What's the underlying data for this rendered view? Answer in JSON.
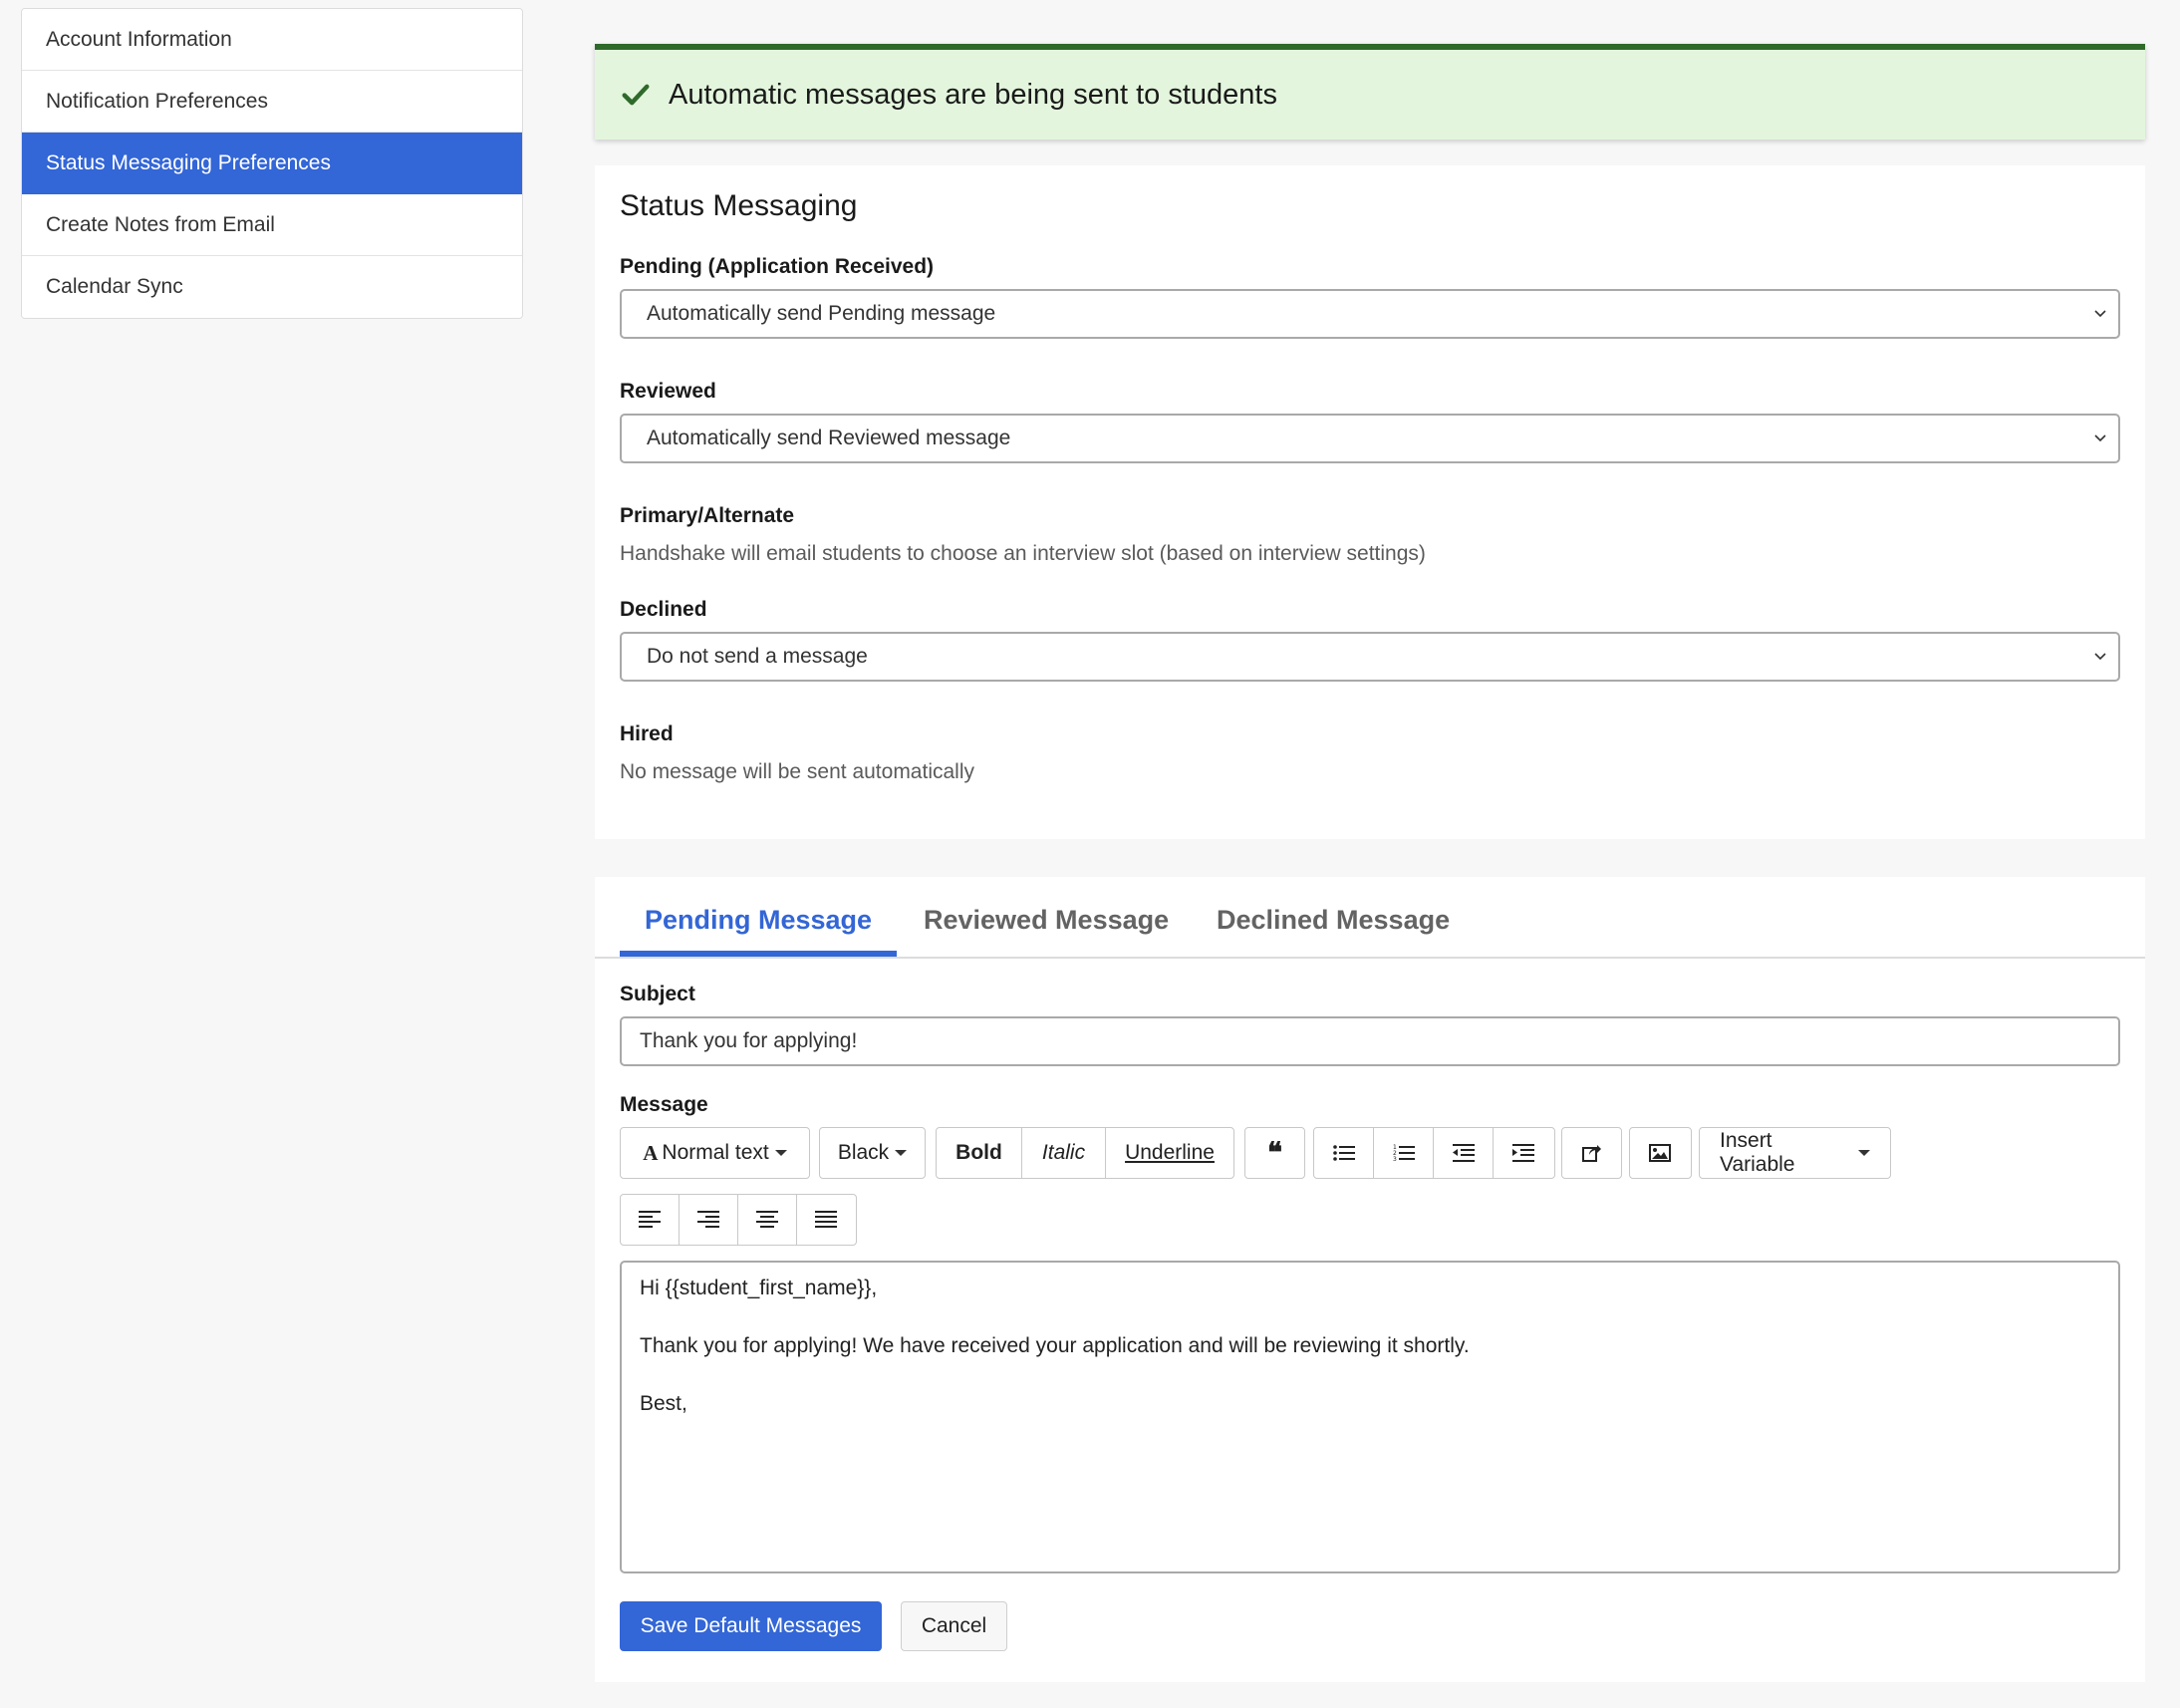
{
  "sidebar": {
    "items": [
      {
        "label": "Account Information"
      },
      {
        "label": "Notification Preferences"
      },
      {
        "label": "Status Messaging Preferences"
      },
      {
        "label": "Create Notes from Email"
      },
      {
        "label": "Calendar Sync"
      }
    ],
    "active_index": 2
  },
  "alert": {
    "text": "Automatic messages are being sent to students",
    "icon": "check-icon"
  },
  "status_messaging": {
    "title": "Status Messaging",
    "pending": {
      "label": "Pending (Application Received)",
      "value": "Automatically send Pending message"
    },
    "reviewed": {
      "label": "Reviewed",
      "value": "Automatically send Reviewed message"
    },
    "primary": {
      "label": "Primary/Alternate",
      "help": "Handshake will email students to choose an interview slot (based on interview settings)"
    },
    "declined": {
      "label": "Declined",
      "value": "Do not send a message"
    },
    "hired": {
      "label": "Hired",
      "help": "No message will be sent automatically"
    }
  },
  "message_editor": {
    "tabs": [
      {
        "label": "Pending Message"
      },
      {
        "label": "Reviewed Message"
      },
      {
        "label": "Declined Message"
      }
    ],
    "active_tab": 0,
    "subject_label": "Subject",
    "subject_value": "Thank you for applying!",
    "message_label": "Message",
    "toolbar": {
      "text_style": "Normal text",
      "color": "Black",
      "bold": "Bold",
      "italic": "Italic",
      "underline": "Underline",
      "insert_variable": "Insert Variable"
    },
    "body": {
      "line1": "Hi {{student_first_name}},",
      "line2": "Thank you for applying! We have received your application and will be reviewing it shortly.",
      "line3": "Best,"
    },
    "save_label": "Save Default Messages",
    "cancel_label": "Cancel"
  },
  "colors": {
    "accent": "#3366d6",
    "success_bg": "#e3f6dd",
    "success_border": "#2f6a2a"
  }
}
